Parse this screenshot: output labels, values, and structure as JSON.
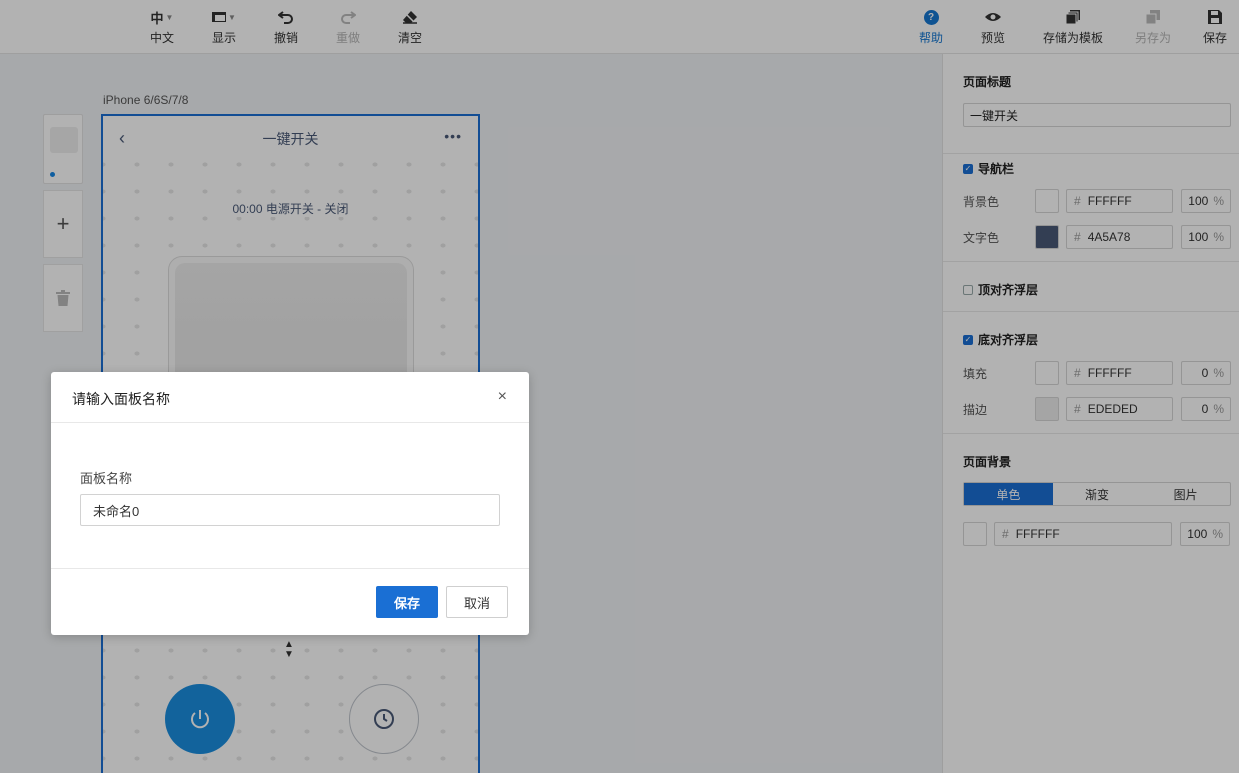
{
  "toolbar": {
    "language": {
      "glyph": "中",
      "label": "中文"
    },
    "display": {
      "label": "显示"
    },
    "undo": {
      "label": "撤销"
    },
    "redo": {
      "label": "重做"
    },
    "clear": {
      "label": "清空"
    },
    "help": {
      "glyph": "?",
      "label": "帮助"
    },
    "preview": {
      "label": "预览"
    },
    "save_template": {
      "label": "存储为模板"
    },
    "save_as": {
      "label": "另存为"
    },
    "save": {
      "label": "保存"
    }
  },
  "canvas": {
    "device_label": "iPhone 6/6S/7/8",
    "nav_title": "一键开关",
    "status_text": "00:00 电源开关 - 关闭"
  },
  "properties": {
    "page_title_section": "页面标题",
    "page_title_value": "一键开关",
    "navbar": {
      "label": "导航栏",
      "checked": true,
      "bg": {
        "name": "背景色",
        "hex": "FFFFFF",
        "pct": "100",
        "color": "#FFFFFF"
      },
      "text": {
        "name": "文字色",
        "hex": "4A5A78",
        "pct": "100",
        "color": "#4A5A78"
      }
    },
    "top_float": {
      "label": "顶对齐浮层",
      "checked": false
    },
    "bottom_float": {
      "label": "底对齐浮层",
      "checked": true,
      "fill": {
        "name": "填充",
        "hex": "FFFFFF",
        "pct": "0",
        "color": "#FFFFFF"
      },
      "stroke": {
        "name": "描边",
        "hex": "EDEDED",
        "pct": "0",
        "color": "#EDEDED"
      }
    },
    "page_bg": {
      "label": "页面背景",
      "tabs": [
        "单色",
        "渐变",
        "图片"
      ],
      "active_tab": "单色",
      "hex": "FFFFFF",
      "pct": "100",
      "color": "#FFFFFF"
    },
    "hash": "#",
    "pct_unit": "%"
  },
  "modal": {
    "title": "请输入面板名称",
    "close": "×",
    "field_label": "面板名称",
    "field_value": "未命名0",
    "save_label": "保存",
    "cancel_label": "取消"
  },
  "colors": {
    "accent": "#1A6FD4",
    "power": "#1A8FE0"
  }
}
